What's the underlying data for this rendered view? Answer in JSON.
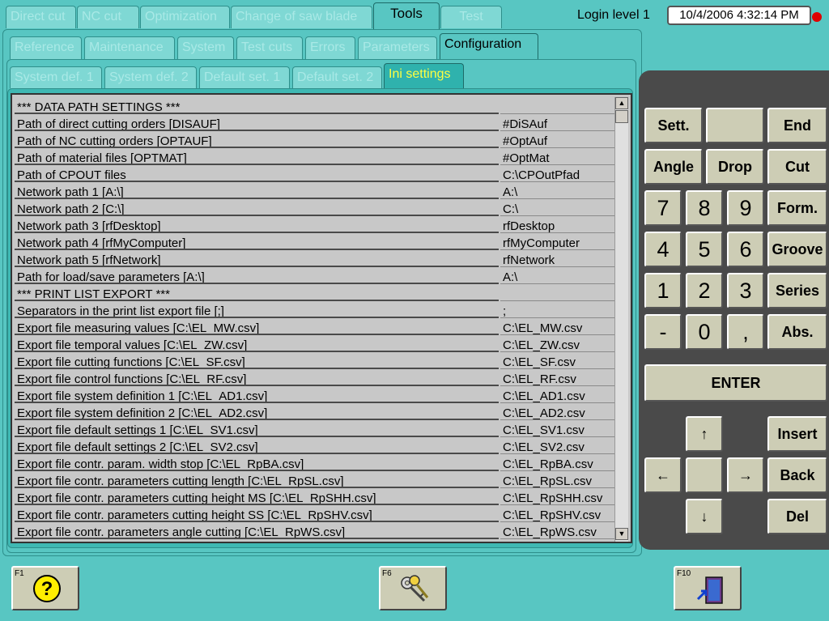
{
  "top_tabs": [
    "Direct cut",
    "NC cut",
    "Optimization",
    "Change of saw blade",
    "Tools",
    "Test"
  ],
  "login_level": "Login level 1",
  "datetime": "10/4/2006 4:32:14 PM",
  "second_tabs": [
    "Reference",
    "Maintenance",
    "System",
    "Test cuts",
    "Errors",
    "Parameters",
    "Configuration"
  ],
  "third_tabs": [
    "System def. 1",
    "System def. 2",
    "Default set. 1",
    "Default set. 2",
    "Ini settings"
  ],
  "rows": [
    {
      "label": "*** DATA PATH SETTINGS ***",
      "value": ""
    },
    {
      "label": "Path of direct cutting orders [DISAUF]",
      "value": "#DiSAuf"
    },
    {
      "label": "Path of NC cutting orders [OPTAUF]",
      "value": "#OptAuf"
    },
    {
      "label": "Path of material files [OPTMAT]",
      "value": "#OptMat"
    },
    {
      "label": "Path of CPOUT files",
      "value": "C:\\CPOutPfad"
    },
    {
      "label": "Network path 1 [A:\\]",
      "value": "A:\\"
    },
    {
      "label": "Network path 2 [C:\\]",
      "value": "C:\\"
    },
    {
      "label": "Network path 3 [rfDesktop]",
      "value": "rfDesktop"
    },
    {
      "label": "Network path 4 [rfMyComputer]",
      "value": "rfMyComputer"
    },
    {
      "label": "Network path 5 [rfNetwork]",
      "value": "rfNetwork"
    },
    {
      "label": "Path for load/save parameters [A:\\]",
      "value": "A:\\"
    },
    {
      "label": "*** PRINT LIST EXPORT ***",
      "value": ""
    },
    {
      "label": "Separators in the print list export file [;]",
      "value": ";"
    },
    {
      "label": "Export file measuring values [C:\\EL_MW.csv]",
      "value": "C:\\EL_MW.csv"
    },
    {
      "label": "Export file temporal values [C:\\EL_ZW.csv]",
      "value": "C:\\EL_ZW.csv"
    },
    {
      "label": "Export file cutting functions [C:\\EL_SF.csv]",
      "value": "C:\\EL_SF.csv"
    },
    {
      "label": "Export file control functions [C:\\EL_RF.csv]",
      "value": "C:\\EL_RF.csv"
    },
    {
      "label": "Export file system definition 1 [C:\\EL_AD1.csv]",
      "value": "C:\\EL_AD1.csv"
    },
    {
      "label": "Export file system definition 2 [C:\\EL_AD2.csv]",
      "value": "C:\\EL_AD2.csv"
    },
    {
      "label": "Export file default settings 1 [C:\\EL_SV1.csv]",
      "value": "C:\\EL_SV1.csv"
    },
    {
      "label": "Export file default settings 2 [C:\\EL_SV2.csv]",
      "value": "C:\\EL_SV2.csv"
    },
    {
      "label": "Export file contr. param. width stop [C:\\EL_RpBA.csv]",
      "value": "C:\\EL_RpBA.csv"
    },
    {
      "label": "Export file contr. parameters cutting length [C:\\EL_RpSL.csv]",
      "value": "C:\\EL_RpSL.csv"
    },
    {
      "label": "Export file contr. parameters cutting height MS [C:\\EL_RpSHH.csv]",
      "value": "C:\\EL_RpSHH.csv"
    },
    {
      "label": "Export file contr. parameters cutting height SS [C:\\EL_RpSHV.csv]",
      "value": "C:\\EL_RpSHV.csv"
    },
    {
      "label": "Export file contr. parameters angle cutting [C:\\EL_RpWS.csv]",
      "value": "C:\\EL_RpWS.csv"
    }
  ],
  "keypad": {
    "sett": "Sett.",
    "blank": "",
    "end": "End",
    "angle": "Angle",
    "drop": "Drop",
    "cut": "Cut",
    "k7": "7",
    "k8": "8",
    "k9": "9",
    "form": "Form.",
    "k4": "4",
    "k5": "5",
    "k6": "6",
    "groove": "Groove",
    "k1": "1",
    "k2": "2",
    "k3": "3",
    "series": "Series",
    "minus": "-",
    "k0": "0",
    "comma": ",",
    "abs": "Abs.",
    "enter": "ENTER",
    "insert": "Insert",
    "back": "Back",
    "del": "Del",
    "up": "↑",
    "left": "←",
    "right": "→",
    "down": "↓"
  },
  "fkeys": {
    "f1": "F1",
    "f6": "F6",
    "f10": "F10"
  },
  "icons": {
    "f1": "question-icon",
    "f6": "keys-icon",
    "f10": "exit-door-icon"
  },
  "colors": {
    "background": "#58c6c2",
    "keypad_panel": "#4a4a4a",
    "key": "#cdcdb5",
    "active_ini_tab_text": "#ffff40",
    "status_dot": "#e00000"
  }
}
